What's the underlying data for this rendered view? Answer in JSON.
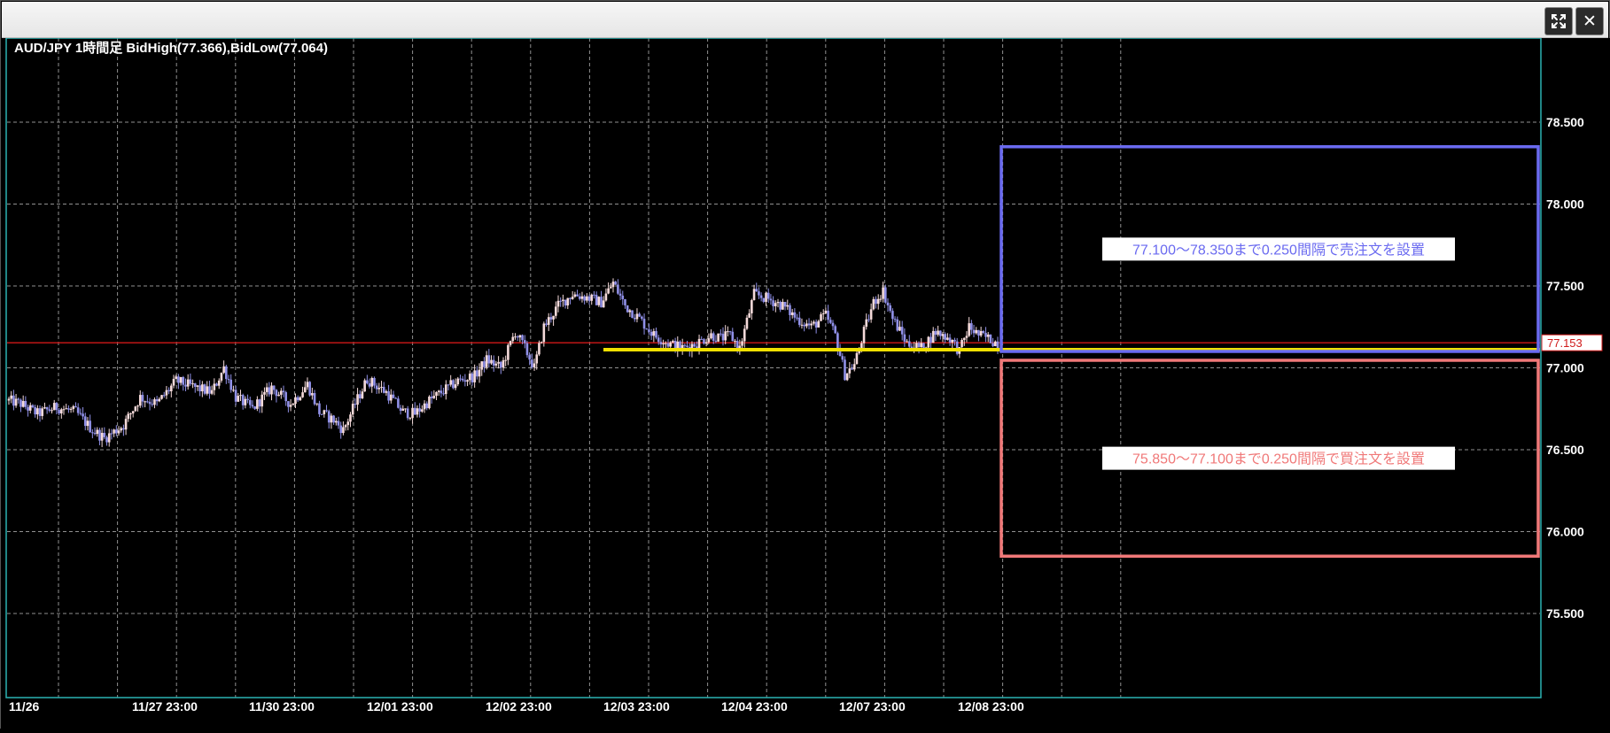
{
  "window": {
    "maximize_icon": "maximize-arrows-icon",
    "close_icon": "close-icon",
    "close_glyph": "✕"
  },
  "chart_data": {
    "type": "candlestick",
    "title": "AUD/JPY 1時間足  BidHigh(77.366),BidLow(77.064)",
    "symbol": "AUD/JPY",
    "timeframe": "1時間足",
    "bid_high": 77.366,
    "bid_low": 77.064,
    "ylim": [
      75.05,
      79.0
    ],
    "yticks": [
      75.5,
      76.0,
      76.5,
      77.0,
      77.5,
      78.0,
      78.5
    ],
    "ytick_labels": [
      "75.500",
      "76.000",
      "76.500",
      "77.000",
      "77.500",
      "78.000",
      "78.500"
    ],
    "x_labels": [
      "11/26",
      "11/27 23:00",
      "11/30 23:00",
      "12/01 23:00",
      "12/02 23:00",
      "12/03 23:00",
      "12/04 23:00",
      "12/07 23:00",
      "12/08 23:00"
    ],
    "current_price": 77.153,
    "current_price_label": "77.153",
    "support_line": 77.1,
    "grid": true,
    "colors": {
      "up_candle": "#f5dada",
      "down_candle": "#9090e8",
      "current_price_line": "#d01818",
      "support_line": "#f0e000",
      "sell_zone": "#6a6af0",
      "buy_zone": "#f07878",
      "grid": "#909090",
      "axis_border": "#2bb3b3"
    },
    "zones": [
      {
        "label": "77.100～78.350まで0.250間隔で売注文を設置",
        "low": 77.1,
        "high": 78.35,
        "kind": "sell"
      },
      {
        "label": "75.850～77.100まで0.250間隔で買注文を設置",
        "low": 75.85,
        "high": 77.1,
        "kind": "buy"
      }
    ],
    "close_anchors": [
      [
        0,
        76.8
      ],
      [
        5,
        76.78
      ],
      [
        12,
        76.72
      ],
      [
        20,
        76.76
      ],
      [
        28,
        76.73
      ],
      [
        35,
        76.62
      ],
      [
        40,
        76.57
      ],
      [
        48,
        76.65
      ],
      [
        55,
        76.82
      ],
      [
        62,
        76.78
      ],
      [
        70,
        76.92
      ],
      [
        78,
        76.88
      ],
      [
        85,
        76.85
      ],
      [
        90,
        77.0
      ],
      [
        95,
        76.82
      ],
      [
        102,
        76.75
      ],
      [
        110,
        76.88
      ],
      [
        118,
        76.78
      ],
      [
        125,
        76.9
      ],
      [
        130,
        76.73
      ],
      [
        136,
        76.68
      ],
      [
        140,
        76.62
      ],
      [
        145,
        76.78
      ],
      [
        150,
        76.93
      ],
      [
        158,
        76.85
      ],
      [
        165,
        76.73
      ],
      [
        170,
        76.72
      ],
      [
        176,
        76.8
      ],
      [
        182,
        76.86
      ],
      [
        188,
        76.92
      ],
      [
        195,
        76.95
      ],
      [
        200,
        77.05
      ],
      [
        206,
        77.0
      ],
      [
        212,
        77.22
      ],
      [
        216,
        77.12
      ],
      [
        220,
        77.0
      ],
      [
        224,
        77.25
      ],
      [
        230,
        77.38
      ],
      [
        236,
        77.45
      ],
      [
        242,
        77.43
      ],
      [
        248,
        77.4
      ],
      [
        253,
        77.52
      ],
      [
        258,
        77.38
      ],
      [
        264,
        77.3
      ],
      [
        270,
        77.2
      ],
      [
        276,
        77.15
      ],
      [
        282,
        77.12
      ],
      [
        288,
        77.15
      ],
      [
        294,
        77.2
      ],
      [
        298,
        77.18
      ],
      [
        302,
        77.2
      ],
      [
        306,
        77.12
      ],
      [
        312,
        77.45
      ],
      [
        318,
        77.42
      ],
      [
        324,
        77.38
      ],
      [
        330,
        77.3
      ],
      [
        336,
        77.25
      ],
      [
        342,
        77.32
      ],
      [
        346,
        77.2
      ],
      [
        350,
        76.96
      ],
      [
        354,
        77.02
      ],
      [
        358,
        77.22
      ],
      [
        362,
        77.4
      ],
      [
        366,
        77.47
      ],
      [
        370,
        77.3
      ],
      [
        376,
        77.15
      ],
      [
        382,
        77.12
      ],
      [
        388,
        77.22
      ],
      [
        394,
        77.18
      ],
      [
        398,
        77.1
      ],
      [
        402,
        77.25
      ],
      [
        406,
        77.2
      ],
      [
        410,
        77.18
      ],
      [
        414,
        77.15
      ]
    ]
  }
}
